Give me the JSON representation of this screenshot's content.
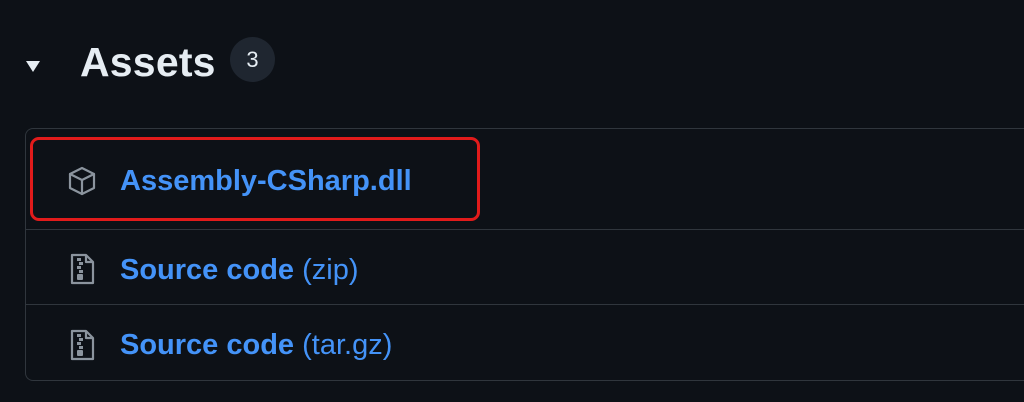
{
  "assets": {
    "title": "Assets",
    "count": "3",
    "items": [
      {
        "name": "Assembly-CSharp.dll",
        "ext": "",
        "icon": "package-icon"
      },
      {
        "name": "Source code",
        "ext": "(zip)",
        "icon": "file-zip-icon"
      },
      {
        "name": "Source code",
        "ext": "(tar.gz)",
        "icon": "file-zip-icon"
      }
    ]
  },
  "colors": {
    "background": "#0d1117",
    "link": "#4493f8",
    "border": "#30363d",
    "highlight": "#e11b1b"
  }
}
